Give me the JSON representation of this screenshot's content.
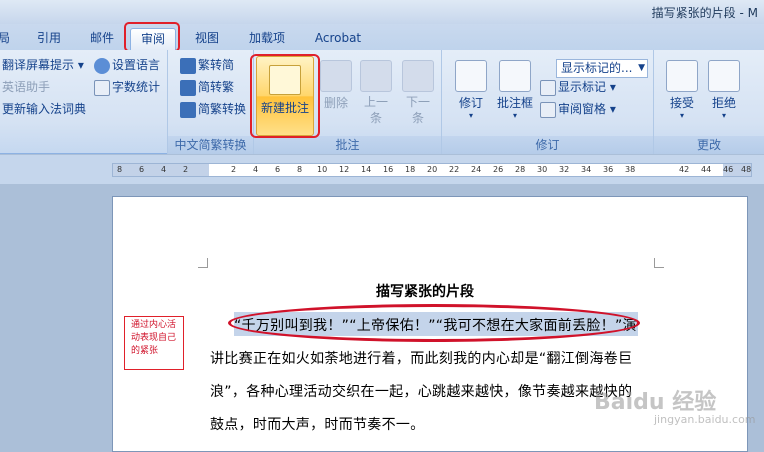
{
  "window": {
    "title": "描写紧张的片段 - M"
  },
  "tabs": [
    {
      "label": "局"
    },
    {
      "label": "引用"
    },
    {
      "label": "邮件"
    },
    {
      "label": "审阅"
    },
    {
      "label": "视图"
    },
    {
      "label": "加载项"
    },
    {
      "label": "Acrobat"
    }
  ],
  "ribbon": {
    "language": {
      "translate_tip": "翻译屏幕提示",
      "set_language": "设置语言",
      "english_assistant": "英语助手",
      "word_count": "字数统计",
      "update_ime_dict": "更新输入法词典"
    },
    "chinese_conversion": {
      "trad_to_simp": "繁转简",
      "simp_to_trad": "简转繁",
      "conversion": "简繁转换",
      "group_label": "中文简繁转换"
    },
    "comments": {
      "new_comment": "新建批注",
      "delete": "删除",
      "previous": "上一条",
      "next": "下一条",
      "group_label": "批注"
    },
    "tracking": {
      "track_changes": "修订",
      "balloons": "批注框",
      "display_markup": "显示标记的...",
      "show_markup": "显示标记",
      "reviewing_pane": "审阅窗格",
      "group_label": "修订"
    },
    "changes": {
      "accept": "接受",
      "reject": "拒绝",
      "group_label": "更改"
    }
  },
  "ruler": {
    "ticks": [
      "8",
      "6",
      "4",
      "2",
      "2",
      "4",
      "6",
      "8",
      "10",
      "12",
      "14",
      "16",
      "18",
      "20",
      "22",
      "24",
      "26",
      "28",
      "30",
      "32",
      "34",
      "36",
      "38",
      "42",
      "44",
      "46",
      "48"
    ]
  },
  "document": {
    "title": "描写紧张的片段",
    "lines": [
      "“千万别叫到我！”“上帝保佑！”“我可不想在大家面前丢脸！”演",
      "讲比赛正在如火如荼地进行着，而此刻我的内心却是“翻江倒海卷巨",
      "浪”，各种心理活动交织在一起，心跳越来越快，像节奏越来越快的",
      "鼓点，时而大声，时而节奏不一。"
    ],
    "annotation_note": "通过内心活动表现自己的紧张"
  },
  "watermark": {
    "logo": "Baidu 经验",
    "url": "jingyan.baidu.com"
  },
  "colors": {
    "highlight_red": "#e0202a",
    "selection": "#c4d4ea",
    "ribbon_text": "#15428b"
  }
}
